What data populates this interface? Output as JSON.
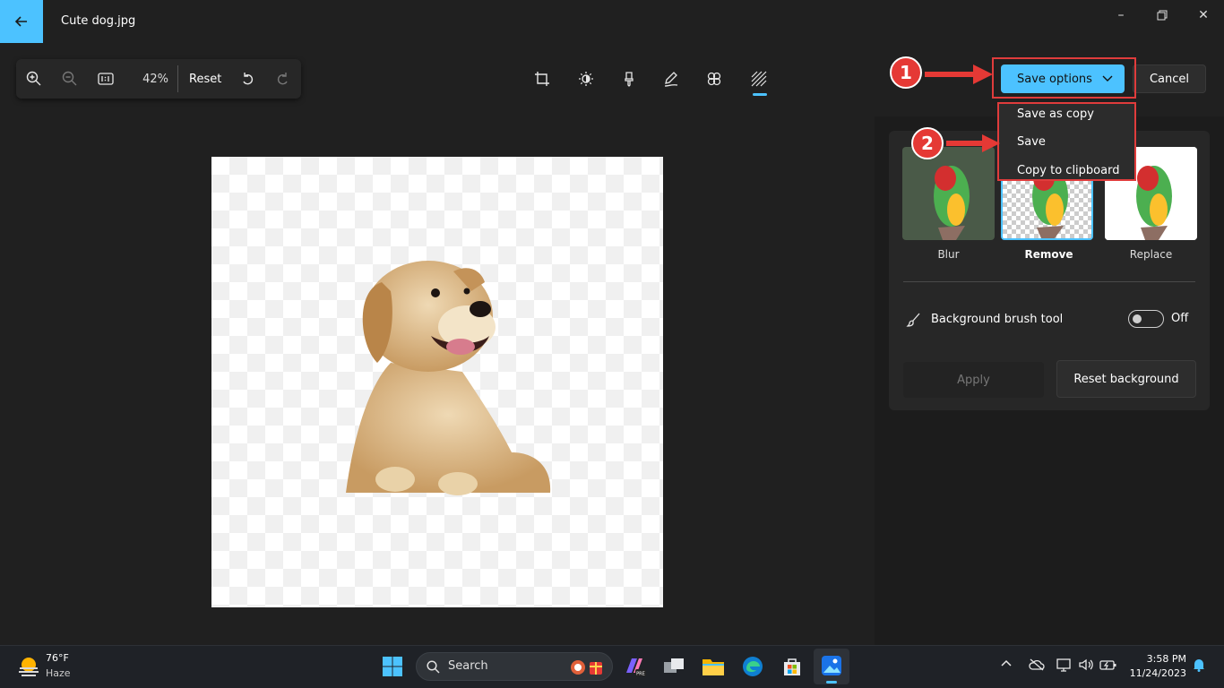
{
  "window": {
    "title": "Cute dog.jpg",
    "back_icon": "arrow-left-icon",
    "controls": [
      "minimize-icon",
      "maximize-icon",
      "close-icon"
    ]
  },
  "zoom_toolbar": {
    "zoom_level": "42%",
    "reset_label": "Reset",
    "icons": [
      "zoom-in-icon",
      "zoom-out-icon",
      "actual-size-icon",
      "undo-icon",
      "redo-icon"
    ]
  },
  "edit_tools": {
    "items": [
      "crop-icon",
      "adjust-icon",
      "markup-icon",
      "draw-icon",
      "effects-icon",
      "background-icon"
    ],
    "active": "background-icon"
  },
  "actions": {
    "save_options_label": "Save options",
    "cancel_label": "Cancel",
    "menu": [
      "Save as copy",
      "Save",
      "Copy to clipboard"
    ]
  },
  "background_panel": {
    "options": [
      {
        "label": "Blur",
        "selected": false
      },
      {
        "label": "Remove",
        "selected": true
      },
      {
        "label": "Replace",
        "selected": false
      }
    ],
    "brush_tool_label": "Background brush tool",
    "brush_toggle_state": "Off",
    "apply_label": "Apply",
    "reset_background_label": "Reset background"
  },
  "annotations": {
    "step1": "1",
    "step2": "2"
  },
  "taskbar": {
    "weather_temp": "76°F",
    "weather_desc": "Haze",
    "search_label": "Search",
    "time": "3:58 PM",
    "date": "11/24/2023"
  },
  "colors": {
    "accent": "#4cc2ff",
    "annotation_red": "#e53935",
    "background": "#202020"
  }
}
